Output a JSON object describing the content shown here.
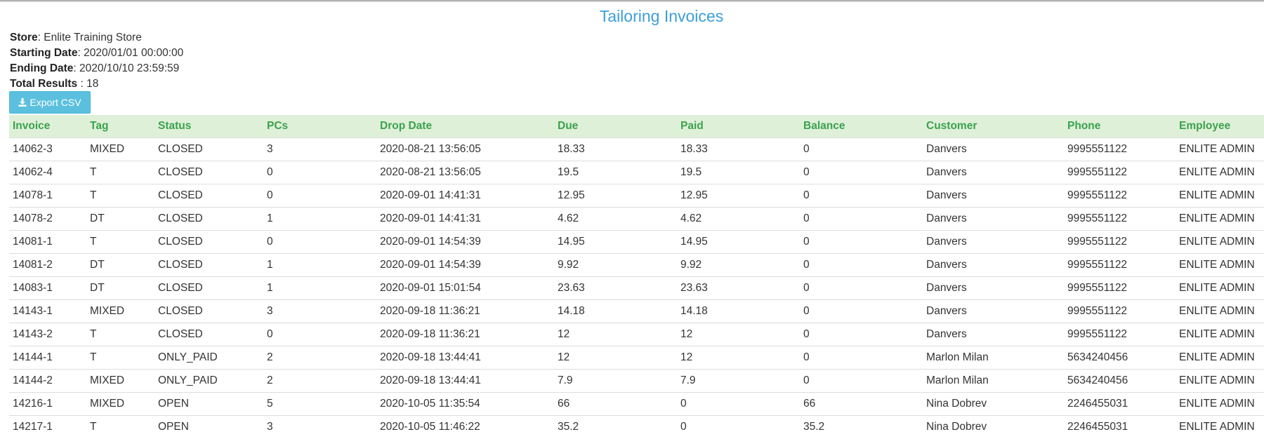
{
  "page_title": "Tailoring Invoices",
  "meta": {
    "store_label": "Store",
    "store_value": ": Enlite Training Store",
    "start_label": "Starting Date",
    "start_value": ": 2020/01/01 00:00:00",
    "end_label": "Ending Date",
    "end_value": ": 2020/10/10 23:59:59",
    "total_label": "Total Results",
    "total_value": " : 18"
  },
  "export_button": {
    "label": "Export CSV",
    "icon": "download-icon"
  },
  "colors": {
    "title": "#3c9fd8",
    "header_bg": "#dff0d8",
    "header_text": "#3aa24f",
    "button_bg": "#5bc0de"
  },
  "table": {
    "columns": [
      "Invoice",
      "Tag",
      "Status",
      "PCs",
      "Drop Date",
      "Due",
      "Paid",
      "Balance",
      "Customer",
      "Phone",
      "Employee"
    ],
    "rows": [
      [
        "14062-3",
        "MIXED",
        "CLOSED",
        "3",
        "2020-08-21 13:56:05",
        "18.33",
        "18.33",
        "0",
        "Danvers",
        "9995551122",
        "ENLITE ADMIN"
      ],
      [
        "14062-4",
        "T",
        "CLOSED",
        "0",
        "2020-08-21 13:56:05",
        "19.5",
        "19.5",
        "0",
        "Danvers",
        "9995551122",
        "ENLITE ADMIN"
      ],
      [
        "14078-1",
        "T",
        "CLOSED",
        "0",
        "2020-09-01 14:41:31",
        "12.95",
        "12.95",
        "0",
        "Danvers",
        "9995551122",
        "ENLITE ADMIN"
      ],
      [
        "14078-2",
        "DT",
        "CLOSED",
        "1",
        "2020-09-01 14:41:31",
        "4.62",
        "4.62",
        "0",
        "Danvers",
        "9995551122",
        "ENLITE ADMIN"
      ],
      [
        "14081-1",
        "T",
        "CLOSED",
        "0",
        "2020-09-01 14:54:39",
        "14.95",
        "14.95",
        "0",
        "Danvers",
        "9995551122",
        "ENLITE ADMIN"
      ],
      [
        "14081-2",
        "DT",
        "CLOSED",
        "1",
        "2020-09-01 14:54:39",
        "9.92",
        "9.92",
        "0",
        "Danvers",
        "9995551122",
        "ENLITE ADMIN"
      ],
      [
        "14083-1",
        "DT",
        "CLOSED",
        "1",
        "2020-09-01 15:01:54",
        "23.63",
        "23.63",
        "0",
        "Danvers",
        "9995551122",
        "ENLITE ADMIN"
      ],
      [
        "14143-1",
        "MIXED",
        "CLOSED",
        "3",
        "2020-09-18 11:36:21",
        "14.18",
        "14.18",
        "0",
        "Danvers",
        "9995551122",
        "ENLITE ADMIN"
      ],
      [
        "14143-2",
        "T",
        "CLOSED",
        "0",
        "2020-09-18 11:36:21",
        "12",
        "12",
        "0",
        "Danvers",
        "9995551122",
        "ENLITE ADMIN"
      ],
      [
        "14144-1",
        "T",
        "ONLY_PAID",
        "2",
        "2020-09-18 13:44:41",
        "12",
        "12",
        "0",
        "Marlon Milan",
        "5634240456",
        "ENLITE ADMIN"
      ],
      [
        "14144-2",
        "MIXED",
        "ONLY_PAID",
        "2",
        "2020-09-18 13:44:41",
        "7.9",
        "7.9",
        "0",
        "Marlon Milan",
        "5634240456",
        "ENLITE ADMIN"
      ],
      [
        "14216-1",
        "MIXED",
        "OPEN",
        "5",
        "2020-10-05 11:35:54",
        "66",
        "0",
        "66",
        "Nina Dobrev",
        "2246455031",
        "ENLITE ADMIN"
      ],
      [
        "14217-1",
        "T",
        "OPEN",
        "3",
        "2020-10-05 11:46:22",
        "35.2",
        "0",
        "35.2",
        "Nina Dobrev",
        "2246455031",
        "ENLITE ADMIN"
      ]
    ]
  }
}
